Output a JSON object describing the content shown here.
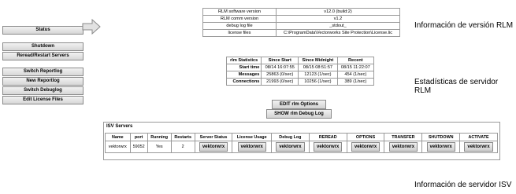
{
  "left_buttons": [
    "Status",
    "Shutdown",
    "Reread/Restart Servers",
    "Switch Reportlog",
    "New Reportlog",
    "Switch Debuglog",
    "Edit License Files"
  ],
  "version_table": [
    [
      "RLM software version",
      "v12.0 (build:2)"
    ],
    [
      "RLM comm version",
      "v1.2"
    ],
    [
      "debug log file",
      "_stdout_"
    ],
    [
      "license files",
      "C:\\ProgramData\\Vectorworks Site Protection\\License.lic"
    ]
  ],
  "captions": {
    "version": "Información de versión RLM",
    "stats_line1": "Estadísticas de servidor",
    "stats_line2": "RLM",
    "isv": "Información de servidor ISV"
  },
  "stats": {
    "headers": [
      "rlm Statistics",
      "Since Start",
      "Since Midnight",
      "Recent"
    ],
    "rows": [
      [
        "Start time",
        "08/14 16:07:55",
        "08/15 08:51:57",
        "08/15 11:22:07"
      ],
      [
        "Messages",
        "25863 (0/sec)",
        "12123 (1/sec)",
        "454 (1/sec)"
      ],
      [
        "Connections",
        "21993 (0/sec)",
        "10256 (1/sec)",
        "389 (1/sec)"
      ]
    ]
  },
  "center_buttons": {
    "edit": "EDIT rlm Options",
    "debug": "SHOW rlm Debug Log"
  },
  "isv": {
    "title": "ISV Servers",
    "headers": [
      "Name",
      "port",
      "Running",
      "Restarts",
      "Server Status",
      "License Usage",
      "Debug Log",
      "REREAD",
      "OPTIONS",
      "TRANSFER",
      "SHUTDOWN",
      "ACTIVATE"
    ],
    "row": {
      "name": "vektorwrx",
      "port": "59052",
      "running": "Yes",
      "restarts": "2",
      "btn_label": "vektorwrx"
    }
  }
}
